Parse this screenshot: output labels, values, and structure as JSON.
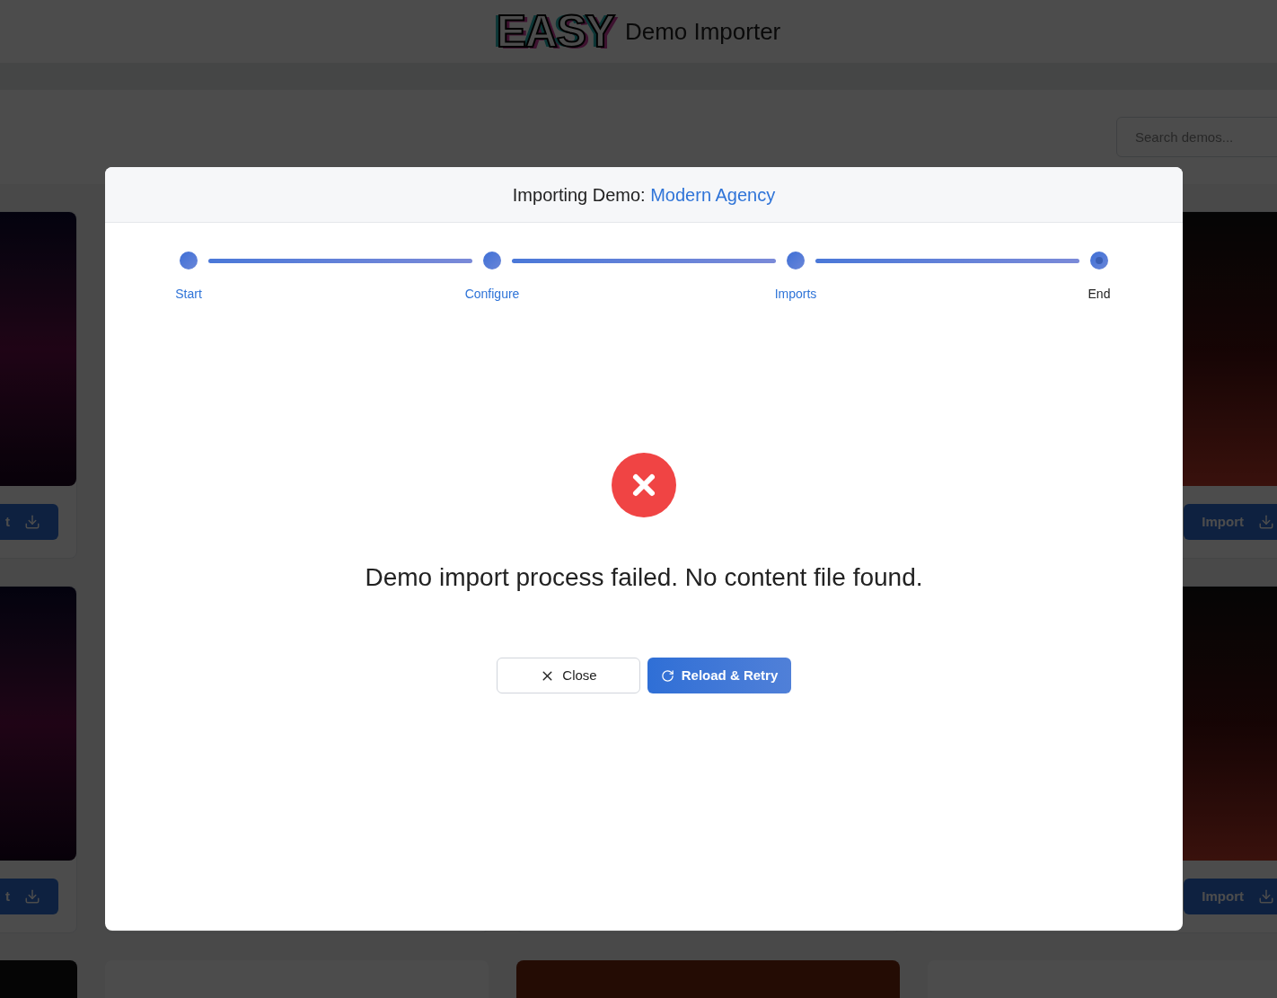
{
  "header": {
    "logo": "EASY",
    "title": "Demo Importer"
  },
  "search": {
    "placeholder": "Search demos..."
  },
  "card_rows": [
    {
      "left_button": "t",
      "right_button": "Import"
    },
    {
      "left_button": "t",
      "right_button": "Import"
    }
  ],
  "modal": {
    "title_prefix": "Importing Demo:",
    "demo_name": "Modern Agency",
    "steps": [
      {
        "label": "Start",
        "completed": true
      },
      {
        "label": "Configure",
        "completed": true
      },
      {
        "label": "Imports",
        "completed": true
      },
      {
        "label": "End",
        "completed": false
      }
    ],
    "failed": true,
    "message": "Demo import process failed. No content file found.",
    "buttons": [
      {
        "kind": "secondary",
        "label": "Close"
      },
      {
        "kind": "primary",
        "label": "Reload & Retry"
      }
    ]
  }
}
